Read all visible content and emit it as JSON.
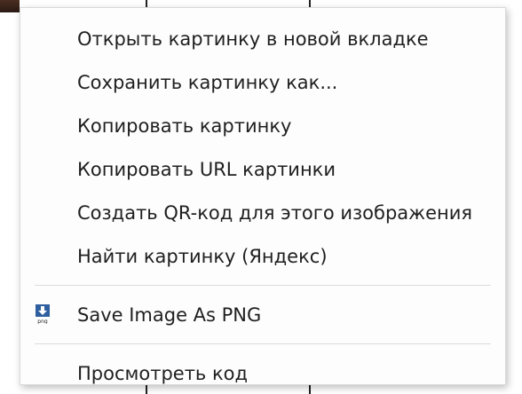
{
  "context_menu": {
    "items": [
      {
        "label": "Открыть картинку в новой вкладке"
      },
      {
        "label": "Сохранить картинку как..."
      },
      {
        "label": "Копировать картинку"
      },
      {
        "label": "Копировать URL картинки"
      },
      {
        "label": "Создать QR-код для этого изображения"
      },
      {
        "label": "Найти картинку (Яндекс)"
      }
    ],
    "extension_item": {
      "label": "Save Image As PNG",
      "icon": "png-download-icon",
      "icon_caption": "png"
    },
    "devtools_item": {
      "label": "Просмотреть код"
    }
  },
  "colors": {
    "menu_background": "#fdfdfd",
    "text": "#1f1f1f",
    "separator": "#dcdcdc",
    "icon_blue": "#2f5f9e"
  }
}
